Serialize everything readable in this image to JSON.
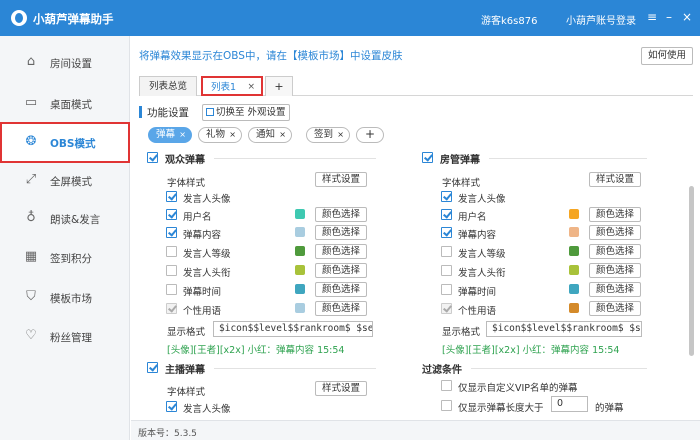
{
  "app": {
    "title": "小葫芦弹幕助手",
    "guest": "游客k6s876",
    "login": "小葫芦账号登录"
  },
  "window": {
    "menu": "≡",
    "minimize": "–",
    "close": "×"
  },
  "sidebar": {
    "items": [
      {
        "label": "房间设置",
        "icon": "home-icon",
        "glyph": "⌂"
      },
      {
        "label": "桌面模式",
        "icon": "desktop-icon",
        "glyph": "▭"
      },
      {
        "label": "OBS模式",
        "icon": "obs-icon",
        "glyph": "❂",
        "active": true
      },
      {
        "label": "全屏模式",
        "icon": "fullscreen-icon",
        "glyph": "⤢"
      },
      {
        "label": "朗读&发言",
        "icon": "microphone-icon",
        "glyph": "♁"
      },
      {
        "label": "签到积分",
        "icon": "calendar-icon",
        "glyph": "▦"
      },
      {
        "label": "模板市场",
        "icon": "shirt-icon",
        "glyph": "⛉"
      },
      {
        "label": "粉丝管理",
        "icon": "heart-icon",
        "glyph": "♡"
      }
    ]
  },
  "main": {
    "tip": "将弹幕效果显示在OBS中，请在【模板市场】中设置皮肤",
    "howto": "如何使用",
    "tabs": [
      "列表总览",
      "列表1",
      "+"
    ],
    "tab_close": "×",
    "func_title": "功能设置",
    "switch_label": "切换至 外观设置",
    "chips": [
      "弹幕",
      "礼物",
      "通知",
      "签到",
      "+"
    ],
    "chip_close": "×"
  },
  "audience": {
    "title": "观众弹幕",
    "font_style": "字体样式",
    "style_btn": "样式设置",
    "rows": [
      {
        "label": "发言人头像",
        "state": "on"
      },
      {
        "label": "用户名",
        "state": "on",
        "color": "#3ec9b1"
      },
      {
        "label": "弹幕内容",
        "state": "on",
        "color": "#a9cde0"
      },
      {
        "label": "发言人等级",
        "state": "off",
        "color": "#4f9a3c"
      },
      {
        "label": "发言人头衔",
        "state": "off",
        "color": "#a8c23a"
      },
      {
        "label": "弹幕时间",
        "state": "off",
        "color": "#3fa6bf"
      },
      {
        "label": "个性用语",
        "state": "dis",
        "color": "#a9cde0"
      }
    ],
    "color_btn": "颜色选择",
    "fmt_label": "显示格式",
    "fmt_value": "$icon$$level$$rankroom$ $sender",
    "preview": "[头像][王者][x2x] 小红：弹幕内容 15:54"
  },
  "manager": {
    "title": "房管弹幕",
    "font_style": "字体样式",
    "style_btn": "样式设置",
    "rows": [
      {
        "label": "发言人头像",
        "state": "on"
      },
      {
        "label": "用户名",
        "state": "on",
        "color": "#f5a623"
      },
      {
        "label": "弹幕内容",
        "state": "on",
        "color": "#efb587"
      },
      {
        "label": "发言人等级",
        "state": "off",
        "color": "#4f9a3c"
      },
      {
        "label": "发言人头衔",
        "state": "off",
        "color": "#a8c23a"
      },
      {
        "label": "弹幕时间",
        "state": "off",
        "color": "#3fa6bf"
      },
      {
        "label": "个性用语",
        "state": "dis",
        "color": "#d48a2a"
      }
    ],
    "color_btn": "颜色选择",
    "fmt_label": "显示格式",
    "fmt_value": "$icon$$level$$rankroom$ $sender",
    "preview": "[头像][王者][x2x] 小红：弹幕内容 15:54"
  },
  "anchor": {
    "title": "主播弹幕",
    "font_style": "字体样式",
    "style_btn": "样式设置",
    "row1": "发言人头像"
  },
  "filter": {
    "title": "过滤条件",
    "vip_only": "仅显示自定义VIP名单的弹幕",
    "len_prefix": "仅显示弹幕长度大于",
    "len_value": "0",
    "len_suffix": "的弹幕"
  },
  "status": {
    "version": "版本号：5.3.5"
  },
  "colors": {
    "accent": "#2b86d6",
    "highlight": "#e03434",
    "preview": "#2ea24f"
  }
}
